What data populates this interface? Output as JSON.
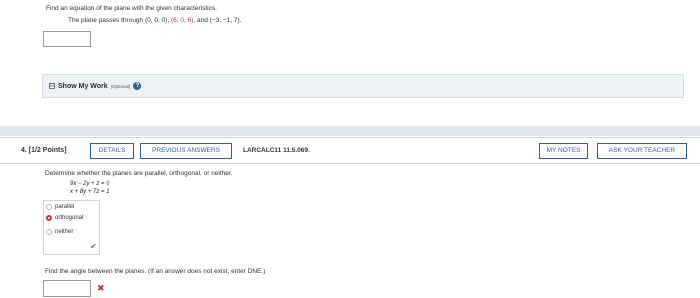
{
  "part1": {
    "instruction": "Find an equation of the plane with the given characteristics.",
    "problem_prefix": "The plane passes through (0, 0, 0), ",
    "problem_point_red": "(6, 0, 6)",
    "problem_suffix": ", and (−3, −1, 7).",
    "answer_value": ""
  },
  "show_work": {
    "toggle": "⊟",
    "label": "Show My Work",
    "optional": "(Optional)",
    "help": "?"
  },
  "question4": {
    "number": "4.",
    "points": "[1/2 Points]",
    "details_label": "DETAILS",
    "previous_answers_label": "PREVIOUS ANSWERS",
    "code": "LARCALC11 11.5.069.",
    "my_notes_label": "MY NOTES",
    "ask_teacher_label": "ASK YOUR TEACHER",
    "prompt": "Determine whether the planes are parallel, orthogonal, or neither.",
    "eq1": "9x − 2y + z = ",
    "eq1_rhs": "8",
    "eq2": "x + 8y + 7z = 1",
    "choices": [
      {
        "label": "parallel",
        "selected": false
      },
      {
        "label": "orthogonal",
        "selected": true
      },
      {
        "label": "neither",
        "selected": false
      }
    ],
    "angle_prompt": "Find the angle between the planes. (If an answer does not exist, enter DNE.)",
    "angle_value": ""
  }
}
